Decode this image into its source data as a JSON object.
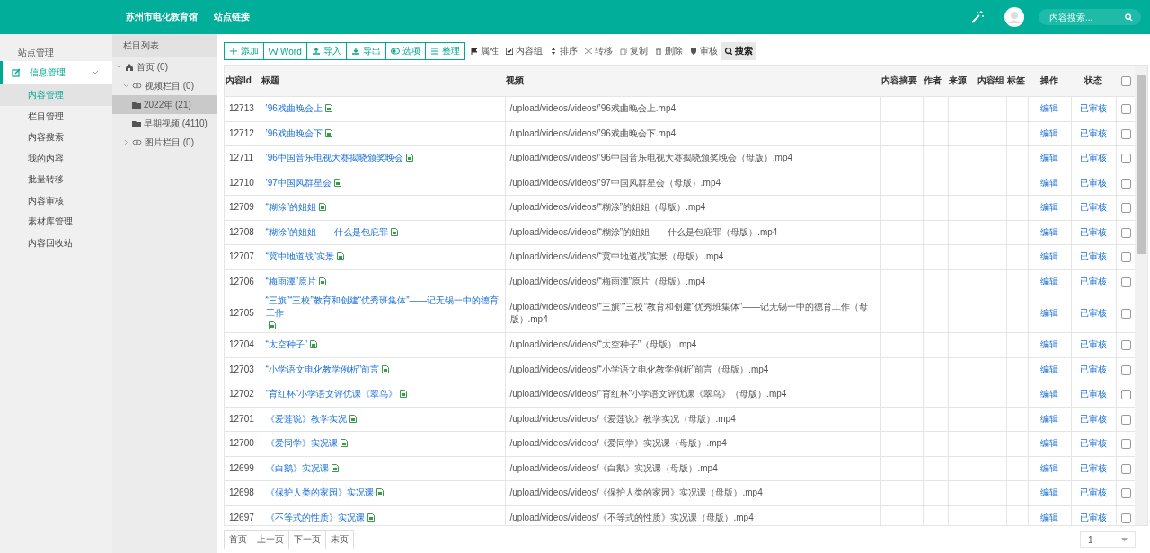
{
  "header": {
    "links": [
      "苏州市电化教育馆",
      "站点链接"
    ],
    "search": {
      "placeholder": "内容搜索..."
    }
  },
  "sidebar": {
    "title": "站点管理",
    "group": {
      "label": "信息管理",
      "expanded": true,
      "items": [
        {
          "label": "内容管理",
          "selected": true
        },
        {
          "label": "栏目管理",
          "selected": false
        },
        {
          "label": "内容搜索",
          "selected": false
        },
        {
          "label": "我的内容",
          "selected": false
        },
        {
          "label": "批量转移",
          "selected": false
        },
        {
          "label": "内容审核",
          "selected": false
        },
        {
          "label": "素材库管理",
          "selected": false
        },
        {
          "label": "内容回收站",
          "selected": false
        }
      ]
    }
  },
  "tree": {
    "title": "栏目列表",
    "nodes": [
      {
        "kind": "home",
        "label": "首页 (0)",
        "expanded": true,
        "selected": false,
        "children": [
          {
            "kind": "link",
            "label": "视频栏目 (0)",
            "expanded": true,
            "selected": false,
            "children": [
              {
                "kind": "folder",
                "label": "2022年 (21)",
                "selected": true
              },
              {
                "kind": "folder",
                "label": "早期视频 (4110)",
                "selected": false
              }
            ]
          },
          {
            "kind": "link",
            "label": "图片栏目 (0)",
            "expanded": false,
            "selected": false
          }
        ]
      }
    ]
  },
  "toolbar": {
    "outlined": [
      {
        "kind": "plus",
        "label": "添加"
      },
      {
        "kind": "word",
        "label": "Word"
      },
      {
        "kind": "upload",
        "label": "导入"
      },
      {
        "kind": "download",
        "label": "导出"
      },
      {
        "kind": "toggle",
        "label": "选项"
      },
      {
        "kind": "list",
        "label": "整理"
      }
    ],
    "plain": [
      {
        "kind": "flag",
        "label": "属性",
        "selected": false
      },
      {
        "kind": "check",
        "label": "内容组",
        "selected": false
      },
      {
        "kind": "sort",
        "label": "排序",
        "selected": false
      },
      {
        "kind": "cut",
        "label": "转移",
        "selected": false
      },
      {
        "kind": "copy",
        "label": "复制",
        "selected": false
      },
      {
        "kind": "trash",
        "label": "删除",
        "selected": false
      },
      {
        "kind": "shield",
        "label": "审核",
        "selected": false
      },
      {
        "kind": "search",
        "label": "搜索",
        "selected": true
      }
    ]
  },
  "table": {
    "columns": [
      "内容Id",
      "标题",
      "视频",
      "内容摘要",
      "作者",
      "来源",
      "内容组",
      "标签",
      "操作",
      "状态"
    ],
    "all_checked": false,
    "rows": [
      {
        "id": "12713",
        "title": "’96戏曲晚会上",
        "video": "/upload/videos/videos/’96戏曲晚会上.mp4",
        "action": "编辑",
        "status": "已审核",
        "checked": false
      },
      {
        "id": "12712",
        "title": "’96戏曲晚会下",
        "video": "/upload/videos/videos/’96戏曲晚会下.mp4",
        "action": "编辑",
        "status": "已审核",
        "checked": false
      },
      {
        "id": "12711",
        "title": "’96中国音乐电视大赛揭晓颁奖晚会",
        "video": "/upload/videos/videos/’96中国音乐电视大赛揭晓颁奖晚会（母版）.mp4",
        "action": "编辑",
        "status": "已审核",
        "checked": false
      },
      {
        "id": "12710",
        "title": "’97中国风群星会",
        "video": "/upload/videos/videos/’97中国风群星会（母版）.mp4",
        "action": "编辑",
        "status": "已审核",
        "checked": false
      },
      {
        "id": "12709",
        "title": "“糊涂”的姐姐",
        "video": "/upload/videos/videos/“糊涂”的姐姐（母版）.mp4",
        "action": "编辑",
        "status": "已审核",
        "checked": false
      },
      {
        "id": "12708",
        "title": "“糊涂”的姐姐——什么是包庇罪",
        "video": "/upload/videos/videos/“糊涂”的姐姐——什么是包庇罪（母版）.mp4",
        "action": "编辑",
        "status": "已审核",
        "checked": false
      },
      {
        "id": "12707",
        "title": "“冀中地道战”实景",
        "video": "/upload/videos/videos/“冀中地道战”实景（母版）.mp4",
        "action": "编辑",
        "status": "已审核",
        "checked": false
      },
      {
        "id": "12706",
        "title": "“梅雨潭”原片",
        "video": "/upload/videos/videos/“梅雨潭”原片（母版）.mp4",
        "action": "编辑",
        "status": "已审核",
        "checked": false
      },
      {
        "id": "12705",
        "title": "“三旗”“三校”教育和创建“优秀班集体”——记无锡一中的德育工作",
        "video": "/upload/videos/videos/“三旗”“三校”教育和创建“优秀班集体”——记无锡一中的德育工作（母版）.mp4",
        "action": "编辑",
        "status": "已审核",
        "checked": false
      },
      {
        "id": "12704",
        "title": "“太空种子”",
        "video": "/upload/videos/videos/“太空种子”（母版）.mp4",
        "action": "编辑",
        "status": "已审核",
        "checked": false
      },
      {
        "id": "12703",
        "title": "“小学语文电化教学例析”前言",
        "video": "/upload/videos/videos/“小学语文电化教学例析”前言（母版）.mp4",
        "action": "编辑",
        "status": "已审核",
        "checked": false
      },
      {
        "id": "12702",
        "title": "“育红杯”小学语文评优课《翠鸟》",
        "video": "/upload/videos/videos/“育红杯”小学语文评优课《翠鸟》（母版）.mp4",
        "action": "编辑",
        "status": "已审核",
        "checked": false
      },
      {
        "id": "12701",
        "title": "《爱莲说》教学实况",
        "video": "/upload/videos/videos/《爱莲说》教学实况（母版）.mp4",
        "action": "编辑",
        "status": "已审核",
        "checked": false
      },
      {
        "id": "12700",
        "title": "《爱同学》实况课",
        "video": "/upload/videos/videos/《爱同学》实况课（母版）.mp4",
        "action": "编辑",
        "status": "已审核",
        "checked": false
      },
      {
        "id": "12699",
        "title": "《白鹅》实况课",
        "video": "/upload/videos/videos/《白鹅》实况课（母版）.mp4",
        "action": "编辑",
        "status": "已审核",
        "checked": false
      },
      {
        "id": "12698",
        "title": "《保护人类的家园》实况课",
        "video": "/upload/videos/videos/《保护人类的家园》实况课（母版）.mp4",
        "action": "编辑",
        "status": "已审核",
        "checked": false
      },
      {
        "id": "12697",
        "title": "《不等式的性质》实况课",
        "video": "/upload/videos/videos/《不等式的性质》实况课（母版）.mp4",
        "action": "编辑",
        "status": "已审核",
        "checked": false
      }
    ]
  },
  "pagination": {
    "buttons": [
      "首页",
      "上一页",
      "下一页",
      "末页"
    ],
    "page": "1"
  }
}
